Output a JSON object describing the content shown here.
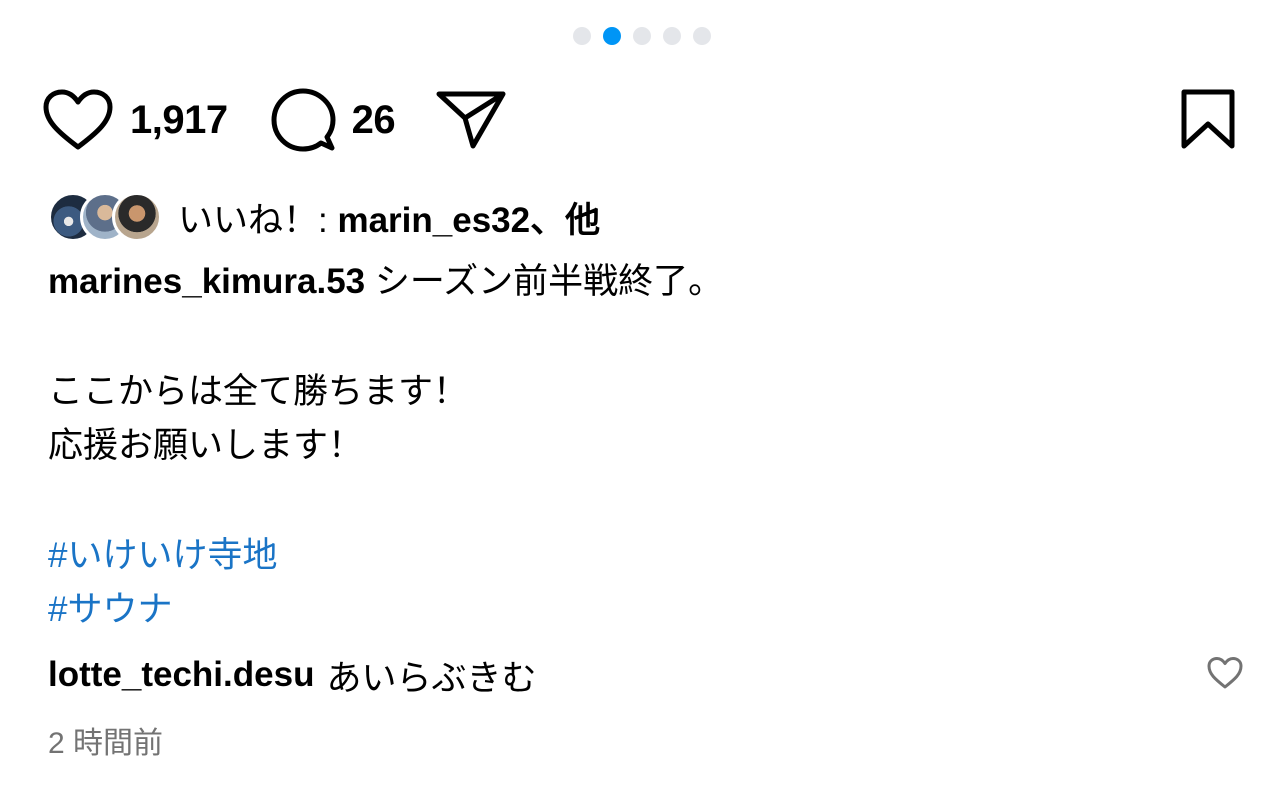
{
  "carousel": {
    "dot_count": 5,
    "active_index": 1,
    "active_color": "#0095f6",
    "inactive_color": "#e4e6ea"
  },
  "actions": {
    "like_icon": "heart-icon",
    "like_count": "1,917",
    "comment_icon": "comment-bubble-icon",
    "comment_count": "26",
    "share_icon": "paper-plane-icon",
    "save_icon": "bookmark-icon"
  },
  "likes": {
    "prefix": "いいね！: ",
    "user": "marin_es32",
    "suffix": "、他"
  },
  "caption": {
    "username": "marines_kimura.53",
    "line1": "シーズン前半戦終了。",
    "line2": "ここからは全て勝ちます！",
    "line3": "応援お願いします！",
    "hashtag1": "#いけいけ寺地",
    "hashtag2": "#サウナ"
  },
  "comment": {
    "username": "lotte_techi.desu",
    "text": "あいらぶきむ",
    "like_icon": "heart-outline-icon"
  },
  "timestamp": "2 時間前",
  "colors": {
    "hashtag": "#1a74c6",
    "secondary_text": "#737373"
  }
}
